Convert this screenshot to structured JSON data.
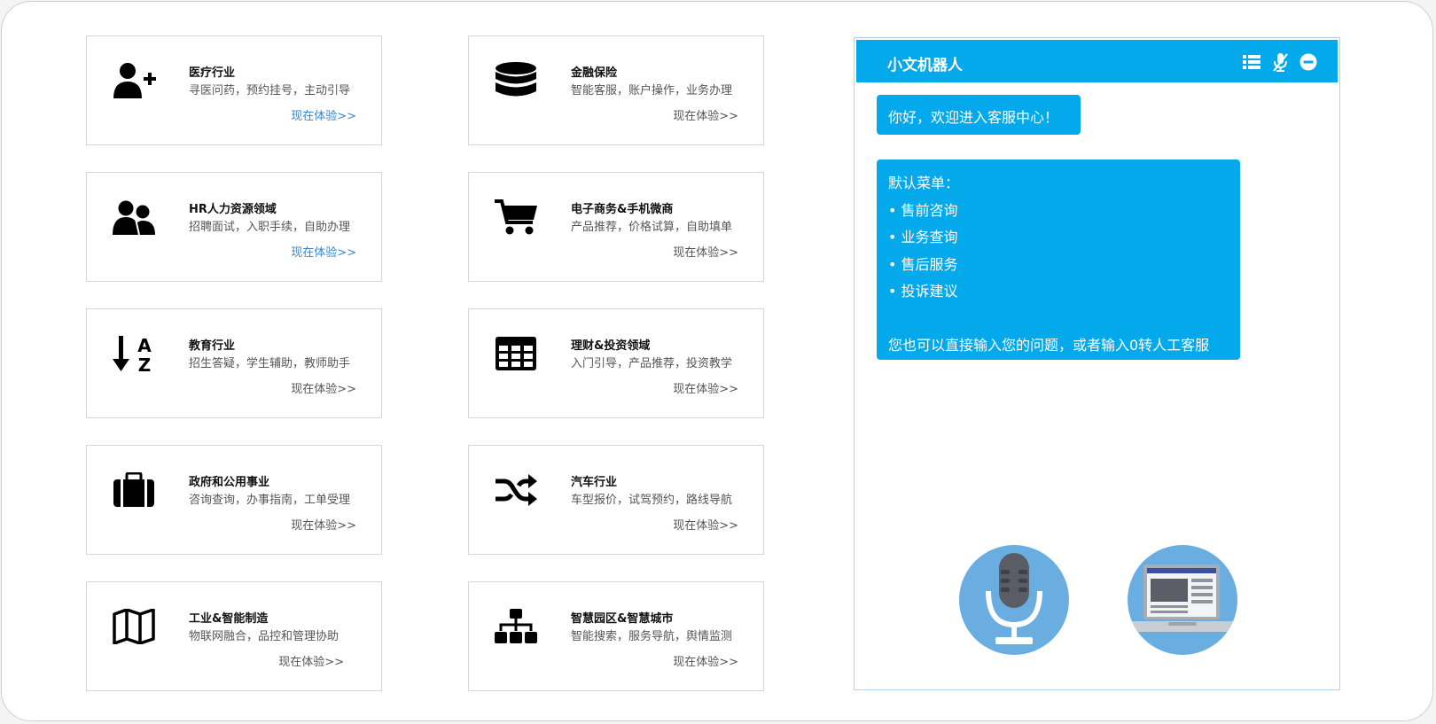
{
  "cards": [
    {
      "icon": "add-user-icon",
      "title": "医疗行业",
      "desc": "寻医问药，预约挂号，主动引导",
      "link": "现在体验>>"
    },
    {
      "icon": "database-icon",
      "title": "金融保险",
      "desc": "智能客服，账户操作，业务办理",
      "link": "现在体验>>"
    },
    {
      "icon": "users-icon",
      "title": "HR人力资源领域",
      "desc": "招聘面试，入职手续，自助办理",
      "link": "现在体验>>"
    },
    {
      "icon": "shopping-cart-icon",
      "title": "电子商务&手机微商",
      "desc": "产品推荐，价格试算，自助填单",
      "link": "现在体验>>"
    },
    {
      "icon": "sort-alpha-icon",
      "title": "教育行业",
      "desc": "招生答疑，学生辅助，教师助手",
      "link": "现在体验>>"
    },
    {
      "icon": "table-icon",
      "title": "理财&投资领域",
      "desc": "入门引导，产品推荐，投资教学",
      "link": "现在体验>>"
    },
    {
      "icon": "briefcase-icon",
      "title": "政府和公用事业",
      "desc": "咨询查询，办事指南，工单受理",
      "link": "现在体验>>"
    },
    {
      "icon": "shuffle-icon",
      "title": "汽车行业",
      "desc": "车型报价，试驾预约，路线导航",
      "link": "现在体验>>"
    },
    {
      "icon": "map-icon",
      "title": "工业&智能制造",
      "desc": "物联网融合，品控和管理协助",
      "link": "现在体验>>"
    },
    {
      "icon": "sitemap-icon",
      "title": "智慧园区&智慧城市",
      "desc": "智能搜索，服务导航，舆情监测",
      "link": "现在体验>>"
    }
  ],
  "chat": {
    "title": "小文机器人",
    "header_icons": [
      "list-icon",
      "mic-off-icon",
      "minus-circle-icon"
    ],
    "greeting": "你好，欢迎进入客服中心！",
    "menu_title": "默认菜单：",
    "menu_items": [
      "• 售前咨询",
      "• 业务查询",
      "• 售后服务",
      "• 投诉建议"
    ],
    "menu_hint": "您也可以直接输入您的问题，或者输入0转人工客服",
    "bottom_buttons": [
      "microphone-icon",
      "laptop-icon"
    ]
  },
  "colors": {
    "accent": "#04a9eb",
    "link_blue": "#3a87c8",
    "circle_blue": "#6aaee1"
  }
}
